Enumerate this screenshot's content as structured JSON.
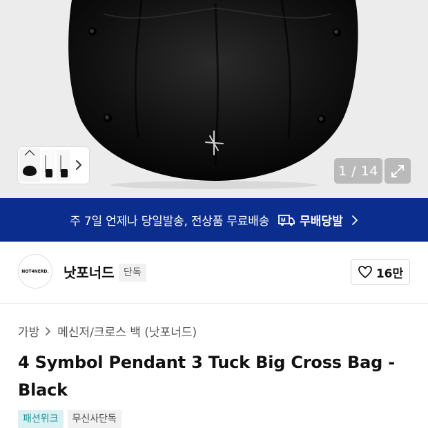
{
  "gallery": {
    "current_page": 1,
    "total_pages": 14,
    "counter_text": "1 / 14",
    "image_icon": "product-bag-image",
    "expand_icon": "expand-icon",
    "thumb_next_icon": "chevron-right-icon"
  },
  "banner": {
    "text": "주 7일 언제나 당일발송, 전상품 무료배송",
    "badge_label": "무배당발",
    "badge_icon": "truck-m-icon",
    "chevron_icon": "chevron-right-icon",
    "bg_color": "#0b2d8e"
  },
  "brand": {
    "logo_text": "NOT4NERD.",
    "name": "낫포너드",
    "tag": "단독",
    "like_count": "16만",
    "like_icon": "heart-icon"
  },
  "product": {
    "breadcrumb": [
      "가방",
      "메신저/크로스 백 (낫포너드)"
    ],
    "breadcrumb_sep_icon": "chevron-right-icon",
    "title": "4 Symbol Pendant 3 Tuck Big Cross Bag - Black",
    "tags": [
      {
        "label": "패션위크",
        "style": "accent"
      },
      {
        "label": "무신사단독",
        "style": "plain"
      }
    ]
  }
}
